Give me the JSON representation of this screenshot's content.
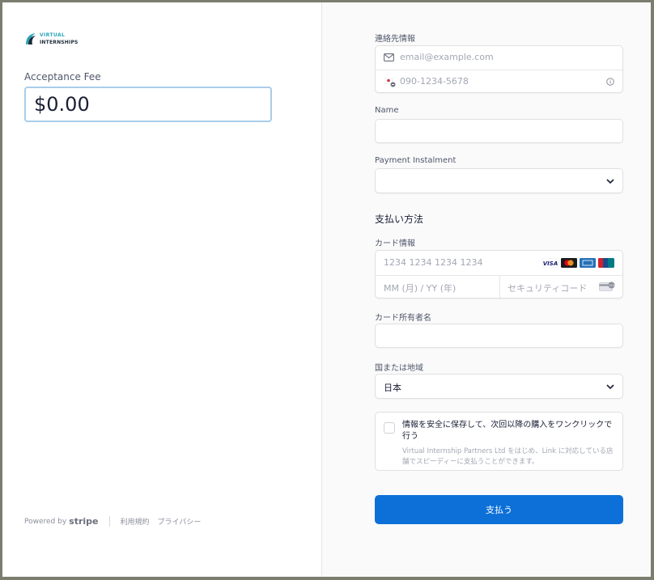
{
  "brand": {
    "line1": "VIRTUAL",
    "line2": "INTERNSHIPS",
    "accent_color": "#2aa5b8"
  },
  "summary": {
    "fee_label": "Acceptance Fee",
    "fee_value": "$0.00"
  },
  "footer": {
    "powered_by": "Powered by",
    "stripe": "stripe",
    "terms": "利用規約",
    "privacy": "プライバシー"
  },
  "contact": {
    "label": "連絡先情報",
    "email_placeholder": "email@example.com",
    "phone_placeholder": "090-1234-5678",
    "email_icon": "envelope-icon",
    "phone_icon": "japan-flag-icon",
    "info_icon": "info-icon"
  },
  "name": {
    "label": "Name",
    "value": ""
  },
  "instalment": {
    "label": "Payment Instalment",
    "value": ""
  },
  "payment": {
    "section_title": "支払い方法",
    "card_label": "カード情報",
    "card_placeholder": "1234 1234 1234 1234",
    "expiry_placeholder": "MM (月) / YY (年)",
    "cvc_placeholder": "セキュリティコード",
    "brands": [
      "VISA",
      "mastercard",
      "AMEX",
      "UnionPay"
    ],
    "cardholder_label": "カード所有者名",
    "cardholder_value": "",
    "country_label": "国または地域",
    "country_value": "日本"
  },
  "save": {
    "title": "情報を安全に保存して、次回以降の購入をワンクリックで行う",
    "description": "Virtual Internship Partners Ltd をはじめ、Link に対応している店舗でスピーディーに支払うことができます。",
    "checked": false
  },
  "submit": {
    "label": "支払う",
    "color": "#0d70d8"
  }
}
